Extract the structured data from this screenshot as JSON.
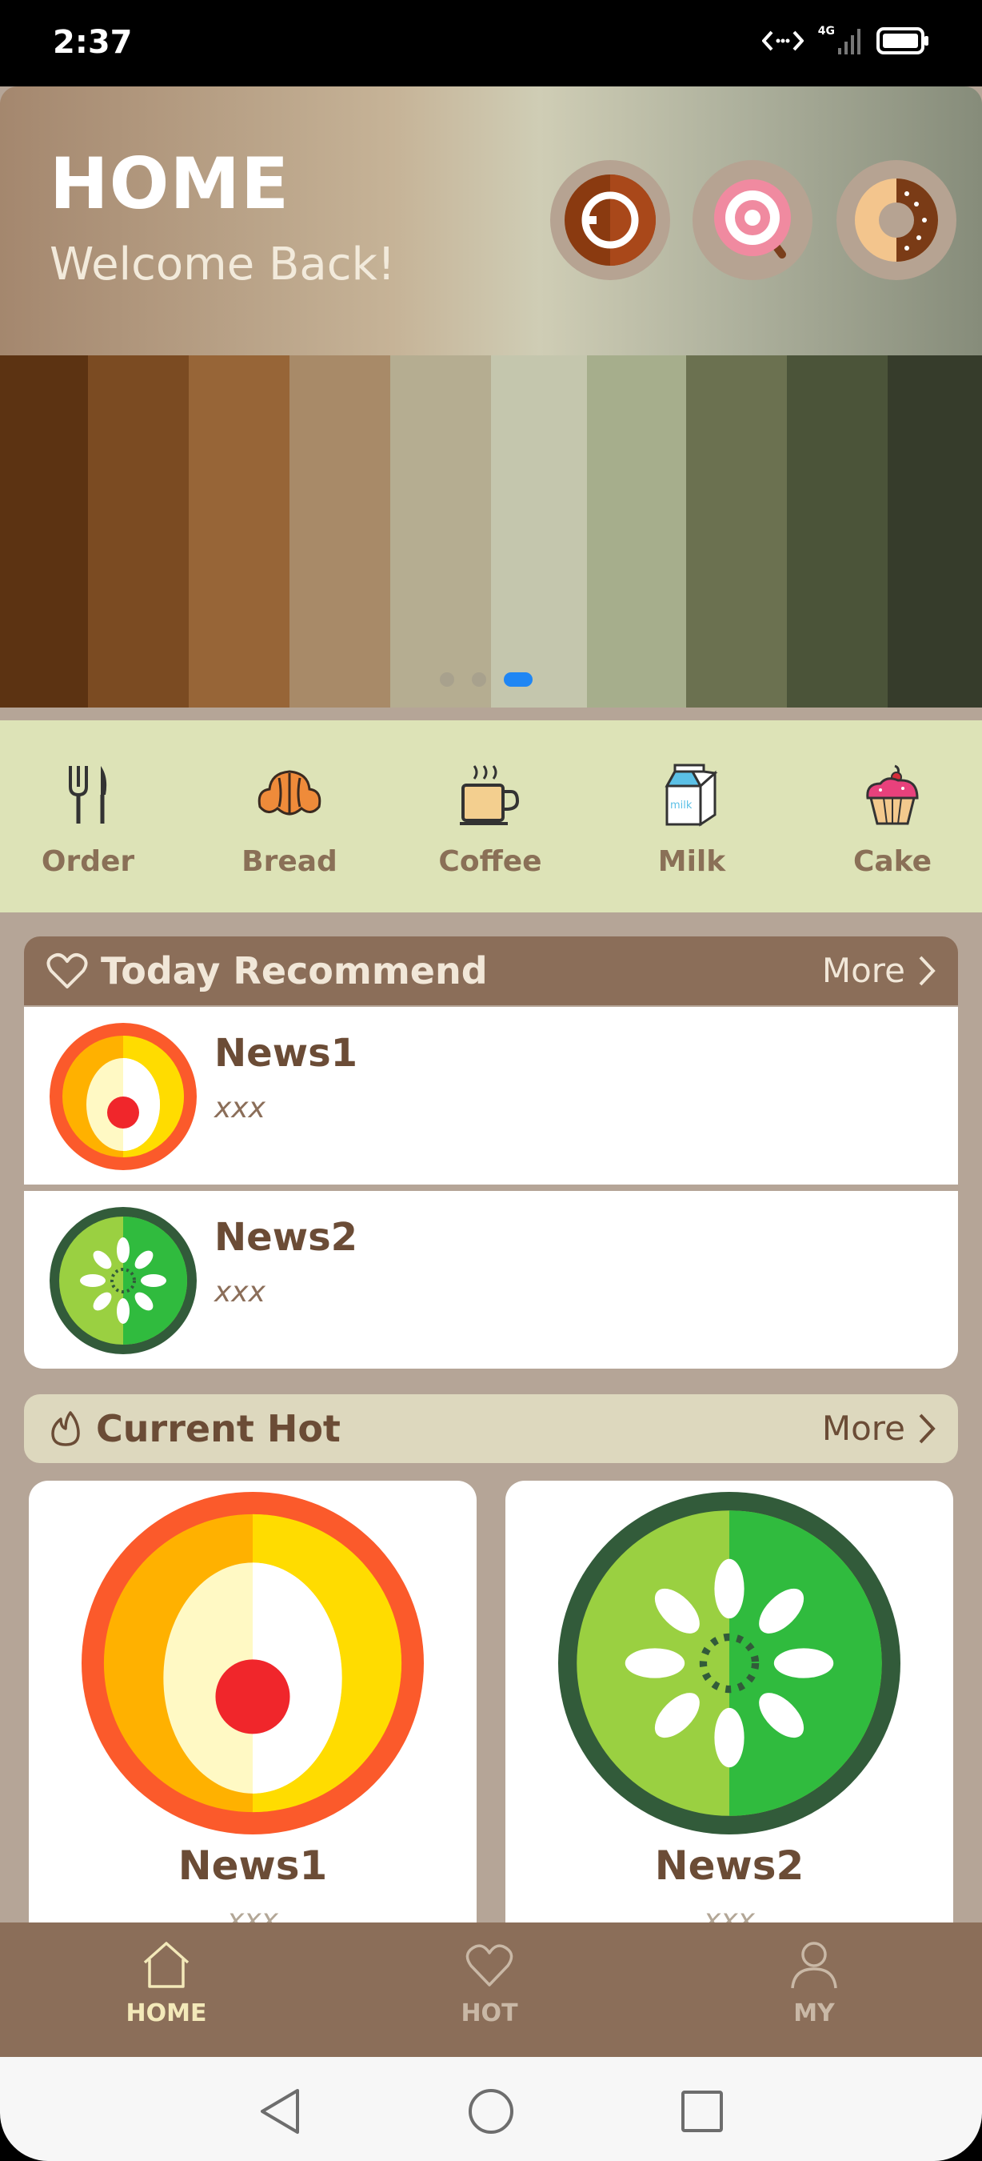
{
  "status_bar": {
    "time": "2:37",
    "network": "4G"
  },
  "header": {
    "title": "HOME",
    "subtitle": "Welcome Back!"
  },
  "carousel": {
    "page_count": 3,
    "active_page": 3
  },
  "palette_colors": [
    "#5c3312",
    "#7b4b22",
    "#976537",
    "#a88a68",
    "#b5ad91",
    "#c4c6ad",
    "#a6ae8c",
    "#6b7150",
    "#4b5439",
    "#363c2b"
  ],
  "categories": [
    {
      "label": "Order",
      "icon": "fork-knife-icon"
    },
    {
      "label": "Bread",
      "icon": "croissant-icon"
    },
    {
      "label": "Coffee",
      "icon": "coffee-cup-icon"
    },
    {
      "label": "Milk",
      "icon": "milk-carton-icon"
    },
    {
      "label": "Cake",
      "icon": "cupcake-icon"
    }
  ],
  "milk_carton_text": "milk",
  "today_recommend": {
    "title": "Today Recommend",
    "more_label": "More",
    "items": [
      {
        "name": "News1",
        "desc": "xxx",
        "icon": "egg-icon"
      },
      {
        "name": "News2",
        "desc": "xxx",
        "icon": "kiwi-icon"
      }
    ]
  },
  "current_hot": {
    "title": "Current Hot",
    "more_label": "More",
    "items": [
      {
        "name": "News1",
        "desc": "xxx",
        "icon": "egg-icon"
      },
      {
        "name": "News2",
        "desc": "xxx",
        "icon": "kiwi-icon"
      }
    ]
  },
  "bottom_nav": {
    "items": [
      {
        "label": "HOME",
        "icon": "house-icon",
        "active": true
      },
      {
        "label": "HOT",
        "icon": "heart-icon",
        "active": false
      },
      {
        "label": "MY",
        "icon": "person-icon",
        "active": false
      }
    ]
  },
  "colors": {
    "accent_brown": "#8b6e59",
    "category_bg": "#dde3b7",
    "text_brown": "#6b4c36",
    "active_nav": "#f3e9b9",
    "inactive_nav": "#c9b8a6",
    "carousel_active_dot": "#1f86f4"
  }
}
